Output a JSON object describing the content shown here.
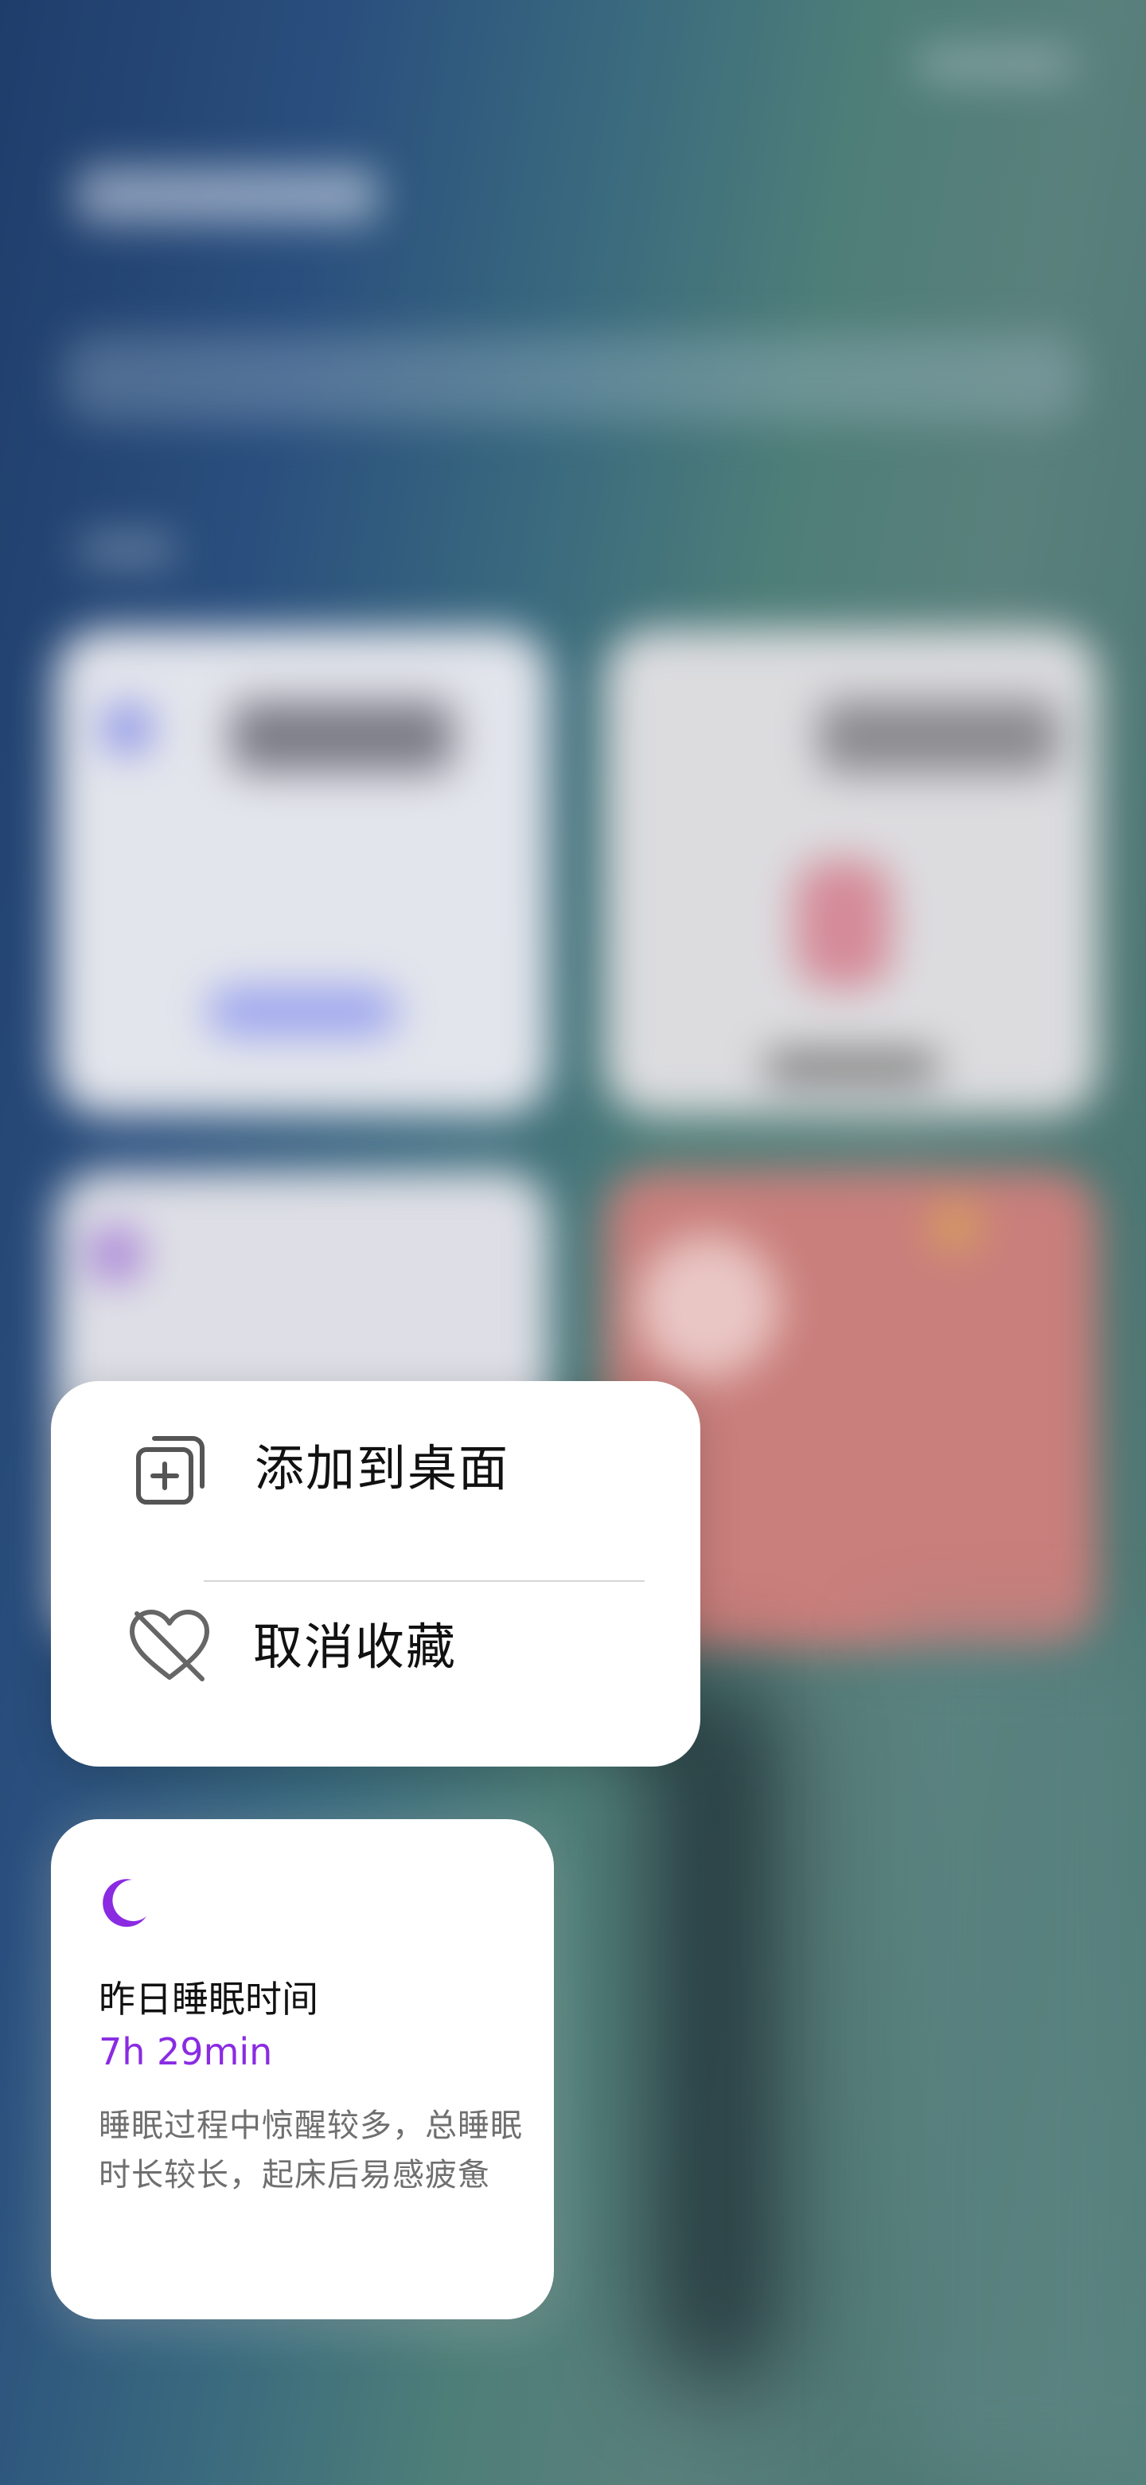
{
  "context_menu": {
    "items": [
      {
        "label": "添加到桌面",
        "icon": "add-to-desktop-icon"
      },
      {
        "label": "取消收藏",
        "icon": "unfavorite-heart-icon"
      }
    ]
  },
  "sleep_card": {
    "icon": "crescent-moon-icon",
    "title": "昨日睡眠时间",
    "value": "7h 29min",
    "description": "睡眠过程中惊醒较多，总睡眠时长较长，起床后易感疲惫"
  },
  "colors": {
    "accent_purple": "#8a2be2",
    "menu_background": "#ffffff",
    "card_background": "#ffffff",
    "description_gray": "#6f6f6f"
  }
}
